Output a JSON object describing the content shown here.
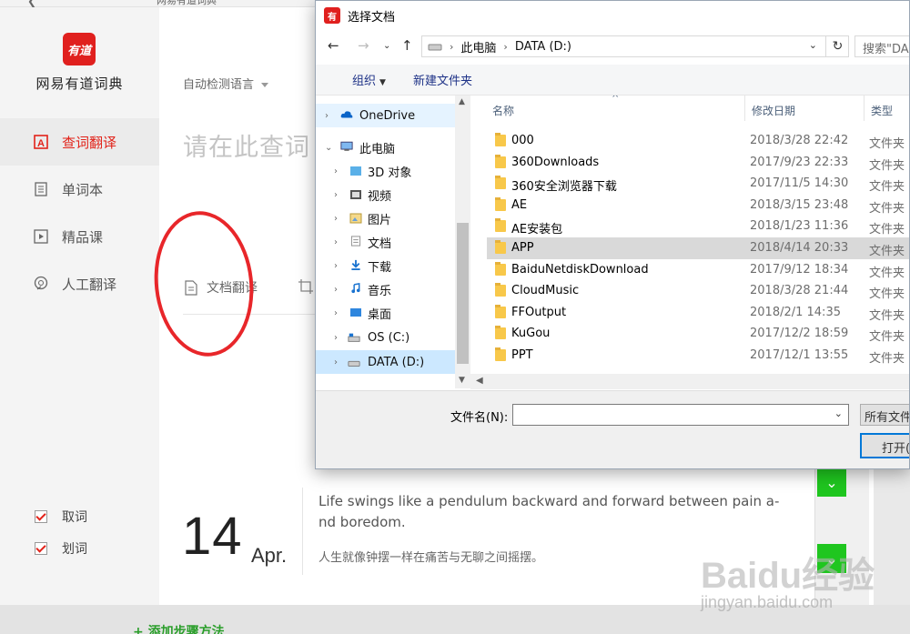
{
  "app": {
    "title_partial": "网易有道词典",
    "brand": "网易有道词典",
    "logo_text": "有道",
    "nav": [
      {
        "label": "查词翻译",
        "icon": "dictionary-icon",
        "active": true
      },
      {
        "label": "单词本",
        "icon": "wordbook-icon",
        "active": false
      },
      {
        "label": "精品课",
        "icon": "video-course-icon",
        "active": false
      },
      {
        "label": "人工翻译",
        "icon": "human-translate-icon",
        "active": false
      }
    ],
    "options": [
      {
        "label": "取词",
        "checked": true
      },
      {
        "label": "划词",
        "checked": true
      }
    ],
    "lang_select": "自动检测语言",
    "input_placeholder": "请在此查词",
    "doc_translate": "文档翻译",
    "daily": {
      "day": "14",
      "month": "Apr.",
      "en": "Life swings like a pendulum backward and forward between pain a-nd boredom.",
      "cn": "人生就像钟摆一样在痛苦与无聊之间摇摆。"
    },
    "add_step": "+ 添加步骤方法",
    "watermark": "Baidu经验",
    "watermark_url": "jingyan.baidu.com",
    "accent": "#e2231a"
  },
  "dialog": {
    "title": "选择文档",
    "path": [
      "此电脑",
      "DATA (D:)"
    ],
    "search_placeholder": "搜索\"DA",
    "cmd_organize": "组织",
    "cmd_new_folder": "新建文件夹",
    "tree": [
      {
        "label": "OneDrive",
        "icon": "cloud-icon"
      },
      {
        "label": "此电脑",
        "icon": "computer-icon"
      },
      {
        "label": "3D 对象",
        "icon": "3d-objects-icon"
      },
      {
        "label": "视频",
        "icon": "video-folder-icon"
      },
      {
        "label": "图片",
        "icon": "pictures-folder-icon"
      },
      {
        "label": "文档",
        "icon": "documents-folder-icon"
      },
      {
        "label": "下载",
        "icon": "downloads-folder-icon"
      },
      {
        "label": "音乐",
        "icon": "music-folder-icon"
      },
      {
        "label": "桌面",
        "icon": "desktop-folder-icon"
      },
      {
        "label": "OS (C:)",
        "icon": "drive-c-icon"
      },
      {
        "label": "DATA (D:)",
        "icon": "drive-d-icon"
      }
    ],
    "columns": {
      "name": "名称",
      "date": "修改日期",
      "type": "类型"
    },
    "files": [
      {
        "name": "000",
        "date": "2018/3/28 22:42",
        "type": "文件夹"
      },
      {
        "name": "360Downloads",
        "date": "2017/9/23 22:33",
        "type": "文件夹"
      },
      {
        "name": "360安全浏览器下载",
        "date": "2017/11/5 14:30",
        "type": "文件夹"
      },
      {
        "name": "AE",
        "date": "2018/3/15 23:48",
        "type": "文件夹"
      },
      {
        "name": "AE安装包",
        "date": "2018/1/23 11:36",
        "type": "文件夹"
      },
      {
        "name": "APP",
        "date": "2018/4/14 20:33",
        "type": "文件夹"
      },
      {
        "name": "BaiduNetdiskDownload",
        "date": "2017/9/12 18:34",
        "type": "文件夹"
      },
      {
        "name": "CloudMusic",
        "date": "2018/3/28 21:44",
        "type": "文件夹"
      },
      {
        "name": "FFOutput",
        "date": "2018/2/1 14:35",
        "type": "文件夹"
      },
      {
        "name": "KuGou",
        "date": "2017/12/2 18:59",
        "type": "文件夹"
      },
      {
        "name": "PPT",
        "date": "2017/12/1 13:55",
        "type": "文件夹"
      }
    ],
    "filename_label": "文件名(N):",
    "filename_value": "",
    "filetype": "所有文件",
    "open_button": "打开(",
    "selected_file": "APP",
    "selected_tree": "DATA (D:)"
  }
}
